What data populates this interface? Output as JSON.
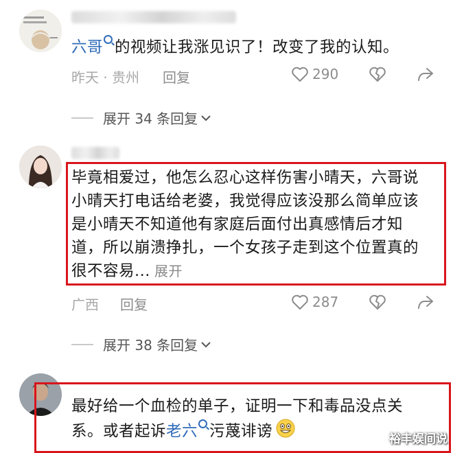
{
  "comments": [
    {
      "mention": "六哥",
      "text_after": "的视频让我涨见识了！改变了我的认知。",
      "meta": "昨天 · 贵州",
      "reply_label": "回复",
      "likes": "290",
      "expand_label": "展开 34 条回复"
    },
    {
      "text": "毕竟相爱过，他怎么忍心这样伤害小晴天，六哥说小晴天打电话给老婆，我觉得应该没那么简单应该是小晴天不知道他有家庭后面付出真感情后才知道，所以崩溃挣扎，一个女孩子走到这个位置真的很不容易...",
      "more_label": "展开",
      "meta": "广西",
      "reply_label": "回复",
      "likes": "287",
      "expand_label": "展开 38 条回复"
    },
    {
      "text_before": "最好给一个血检的单子，证明一下和毒品没点关系。或者起诉",
      "mention": "老六",
      "text_after": "污蔑诽谤"
    }
  ],
  "watermark": "裕丰娱间说",
  "colors": {
    "link": "#2f6bb8",
    "highlight_box": "#d9141b",
    "muted": "#a8a8a8"
  },
  "icons": [
    "heart-outline",
    "broken-heart",
    "share-arrow",
    "chevron-down",
    "search-superscript",
    "grinning-emoji"
  ]
}
